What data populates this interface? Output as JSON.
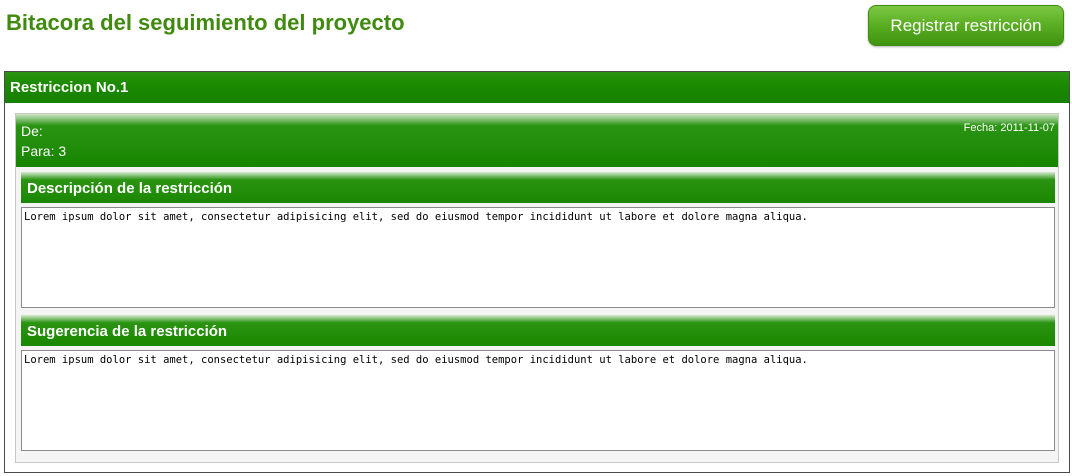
{
  "header": {
    "title": "Bitacora del seguimiento del proyecto",
    "register_button_label": "Registrar restricción"
  },
  "restriction": {
    "title": "Restriccion No.1",
    "de_label": "De:",
    "para_label": "Para: 3",
    "fecha_label": "Fecha: 2011-11-07",
    "descripcion": {
      "heading": "Descripción de la restricción",
      "text": "Lorem ipsum dolor sit amet, consectetur adipisicing elit, sed do eiusmod tempor incididunt ut labore et dolore magna aliqua."
    },
    "sugerencia": {
      "heading": "Sugerencia de la restricción",
      "text": "Lorem ipsum dolor sit amet, consectetur adipisicing elit, sed do eiusmod tempor incididunt ut labore et dolore magna aliqua."
    }
  },
  "colors": {
    "title_green": "#3f8a0f",
    "header_green": "#1c8a00",
    "button_green": "#59ad22"
  }
}
